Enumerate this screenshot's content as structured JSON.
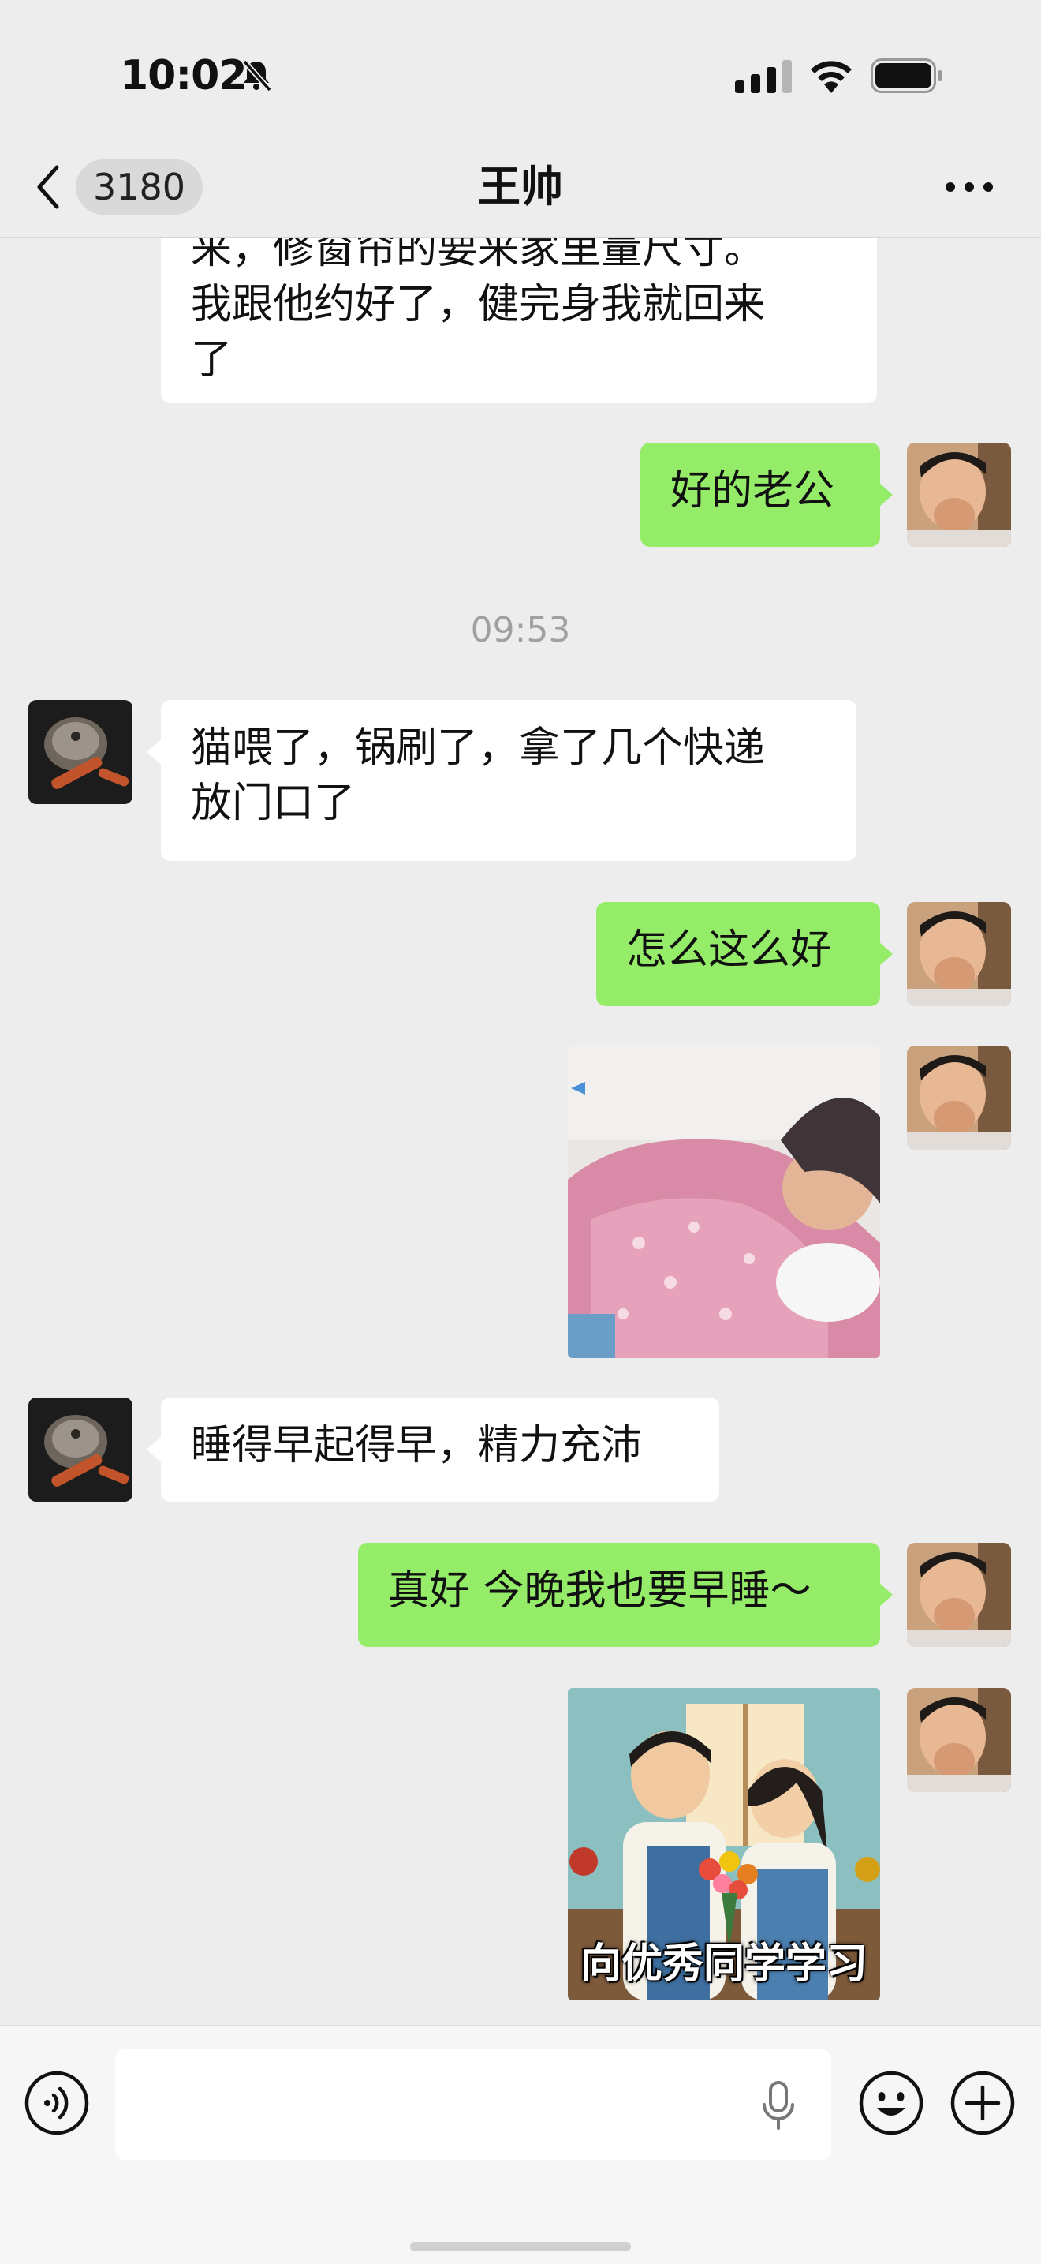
{
  "status_bar": {
    "time": "10:02"
  },
  "nav": {
    "unread_count": "3180",
    "title": "王帅"
  },
  "messages": {
    "m1_line1": "来，修窗帘的要来家里量尺寸。",
    "m1_line2": "我跟他约好了，健完身我就回来",
    "m1_line3": "了",
    "m2": "好的老公",
    "timestamp": "09:53",
    "m3_line1": "猫喂了，锅刷了，拿了几个快递",
    "m3_line2": "放门口了",
    "m4": "怎么这么好",
    "m6": "睡得早起得早，精力充沛",
    "m7": "真好 今晚我也要早睡～",
    "m8_caption": "向优秀同学学习"
  },
  "colors": {
    "outgoing_bubble": "#95ec69",
    "incoming_bubble": "#ffffff",
    "background": "#ededed"
  }
}
